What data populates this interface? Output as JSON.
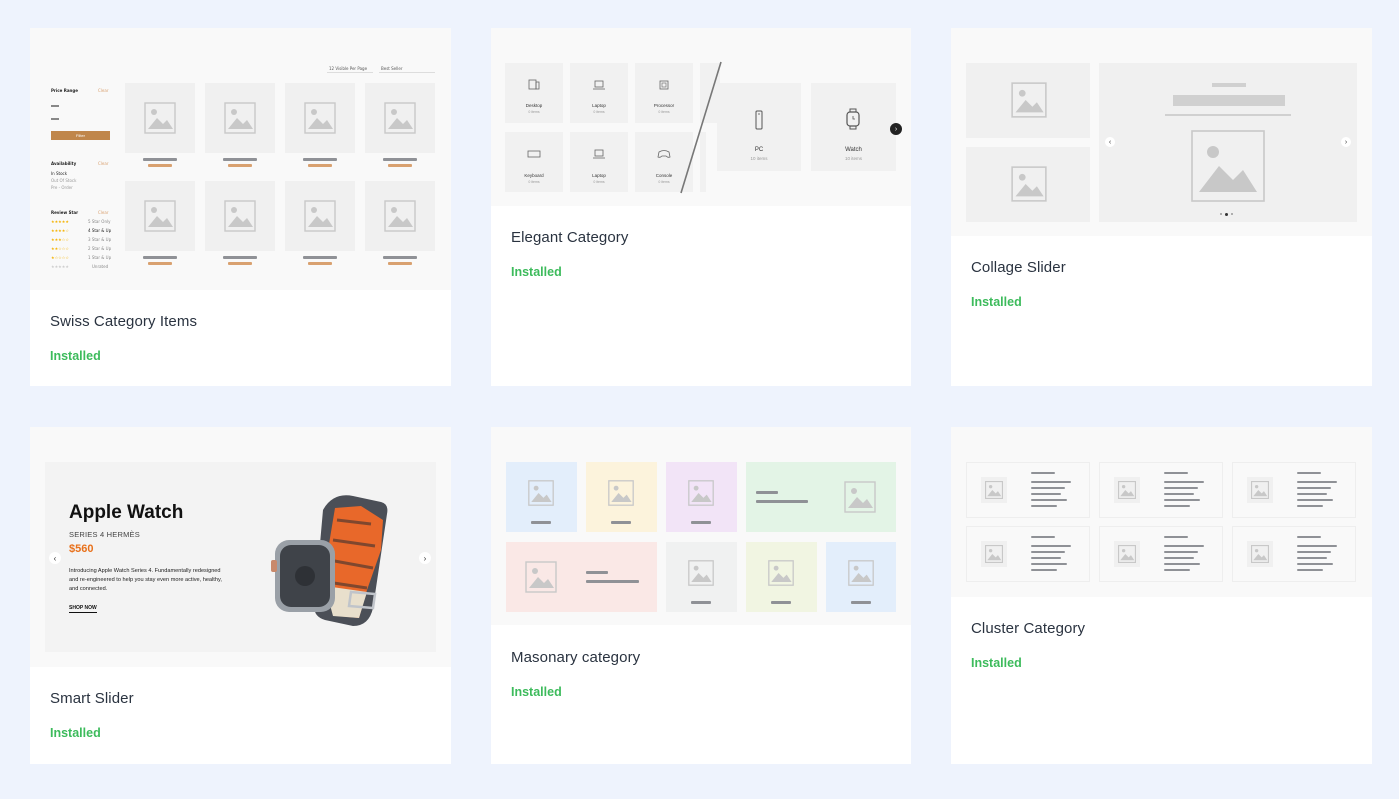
{
  "cards": [
    {
      "title": "Swiss Category Items",
      "status": "Installed"
    },
    {
      "title": "Elegant Category",
      "status": "Installed"
    },
    {
      "title": "Collage Slider",
      "status": "Installed"
    },
    {
      "title": "Smart Slider",
      "status": "Installed"
    },
    {
      "title": "Masonary category",
      "status": "Installed"
    },
    {
      "title": "Cluster Category",
      "status": "Installed"
    }
  ],
  "swiss": {
    "per_page": "12 Visible Per Page",
    "sort": "Best Seller",
    "price_range": "Price Range",
    "clear": "Clear",
    "filter_btn": "Filter",
    "availability": "Availability",
    "in_stock": "In Stock",
    "out_of_stock": "Out Of Stock",
    "pre_order": "Pre - Order",
    "review_star": "Review Star",
    "ratings": [
      "5 Star Only",
      "4 Star & Up",
      "3 Star & Up",
      "2 Star & Up",
      "1 Star & Up",
      "Unrated"
    ]
  },
  "elegant": {
    "tiles": [
      {
        "label": "Desktop",
        "count": "0 items"
      },
      {
        "label": "Laptop",
        "count": "0 items"
      },
      {
        "label": "Processor",
        "count": "0 items"
      },
      {
        "label": "Keyboard",
        "count": "0 items"
      },
      {
        "label": "Laptop",
        "count": "0 items"
      },
      {
        "label": "Console",
        "count": "0 items"
      }
    ],
    "big_tiles": [
      {
        "label": "PC",
        "count": "10 items"
      },
      {
        "label": "Watch",
        "count": "10 items"
      }
    ]
  },
  "smart": {
    "heading": "Apple Watch",
    "subheading": "SERIES 4 HERMÈS",
    "price": "$560",
    "description": "Introducing Apple Watch Series 4. Fundamentally redesigned and re-engineered to help you stay even more active, healthy, and connected.",
    "cta": "SHOP NOW"
  },
  "colors": {
    "background": "#eef3fd",
    "installed": "#3dbb5c",
    "price": "#e8701a",
    "accent_orange": "#d9a170",
    "filter_button": "#c0864a"
  }
}
